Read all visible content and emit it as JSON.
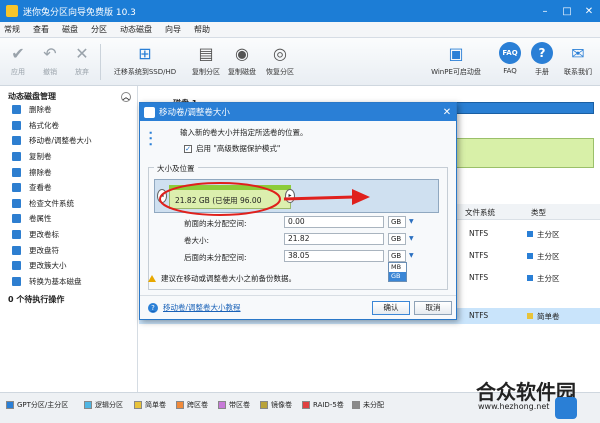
{
  "window": {
    "title": "迷你兔分区向导免费版 10.3"
  },
  "menu": [
    "常规",
    "查看",
    "磁盘",
    "分区",
    "动态磁盘",
    "向导",
    "帮助"
  ],
  "toolbar": {
    "apply": "应用",
    "undo": "撤销",
    "discard": "放弃",
    "migrate": "迁移系统到SSD/HD",
    "copy_partition": "复制分区",
    "copy_disk": "复制磁盘",
    "recover": "恢复分区",
    "winpe": "WinPE可启动盘",
    "faq": "FAQ",
    "manual": "手册",
    "contact": "联系我们"
  },
  "sidebar": {
    "header": "动态磁盘管理",
    "items": [
      "删除卷",
      "格式化卷",
      "移动卷/调整卷大小",
      "复制卷",
      "擦除卷",
      "查看卷",
      "检查文件系统",
      "卷属性",
      "更改卷标",
      "更改盘符",
      "更改簇大小",
      "转换为基本磁盘"
    ],
    "pending": "0 个待执行操作"
  },
  "main": {
    "disk_label": "磁盘 1",
    "columns": {
      "fs": "文件系统",
      "type": "类型"
    },
    "rows": [
      {
        "fs": "NTFS",
        "type": "主分区"
      },
      {
        "fs": "NTFS",
        "type": "主分区"
      },
      {
        "fs": "NTFS",
        "type": "主分区"
      },
      {
        "fs": "NTFS",
        "type": "简单卷"
      }
    ]
  },
  "legend": [
    "GPT分区/主分区",
    "逻辑分区",
    "简单卷",
    "跨区卷",
    "带区卷",
    "镜像卷",
    "RAID-5卷",
    "未分配"
  ],
  "dialog": {
    "title": "移动卷/调整卷大小",
    "description": "输入新的卷大小并指定所选卷的位置。",
    "checkbox": "启用 \"高级数据保护模式\"",
    "group": "大小及位置",
    "volume_text": "21.82 GB (已使用 96.00",
    "before_label": "前面的未分配空间:",
    "before_value": "0.00",
    "size_label": "卷大小:",
    "size_value": "21.82",
    "after_label": "后面的未分配空间:",
    "after_value": "38.05",
    "unit": "GB",
    "unit_options": [
      "MB",
      "GB"
    ],
    "warning": "建议在移动或调整卷大小之前备份数据。",
    "help": "移动卷/调整卷大小教程",
    "ok": "确认",
    "cancel": "取消"
  },
  "watermark": {
    "site": "合众软件园",
    "url": "www.hezhong.net"
  },
  "colors": {
    "accent": "#2a7fd6",
    "title": "#1c7dd6",
    "selected_row": "#c9e4fb",
    "arrow": "#e0201c"
  }
}
